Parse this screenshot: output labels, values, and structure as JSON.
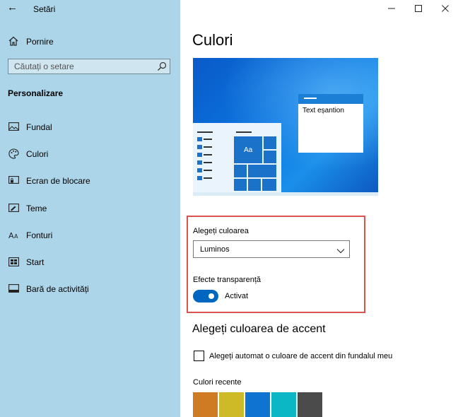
{
  "titlebar": {
    "back_icon": "back-arrow-icon",
    "title": "Setări",
    "controls": [
      "minimize-icon",
      "maximize-icon",
      "close-icon"
    ]
  },
  "sidebar": {
    "home": {
      "label": "Pornire",
      "icon": "home-icon"
    },
    "search": {
      "placeholder": "Căutați o setare",
      "icon": "search-icon"
    },
    "section_title": "Personalizare",
    "items": [
      {
        "label": "Fundal",
        "icon": "picture-icon"
      },
      {
        "label": "Culori",
        "icon": "palette-icon"
      },
      {
        "label": "Ecran de blocare",
        "icon": "lock-screen-icon"
      },
      {
        "label": "Teme",
        "icon": "themes-icon"
      },
      {
        "label": "Fonturi",
        "icon": "fonts-icon"
      },
      {
        "label": "Start",
        "icon": "start-icon"
      },
      {
        "label": "Bară de activități",
        "icon": "taskbar-icon"
      }
    ]
  },
  "main": {
    "title": "Culori",
    "preview": {
      "sample_text": "Text eșantion",
      "tile_text": "Aa"
    },
    "choose_color": {
      "label": "Alegeți culoarea",
      "selected": "Luminos"
    },
    "transparency": {
      "label": "Efecte transparență",
      "state": "Activat",
      "on": true
    },
    "accent": {
      "heading": "Alegeți culoarea de accent",
      "auto_checkbox_label": "Alegeți automat o culoare de accent din fundalul meu",
      "auto_checked": false,
      "recent_label": "Culori recente",
      "recent_colors": [
        "#ce7b24",
        "#ceba26",
        "#0f73d1",
        "#0bb7c4",
        "#4b4b4b"
      ]
    }
  },
  "colors": {
    "sidebar_bg": "#acd5e9",
    "accent": "#0067c0",
    "highlight_border": "#d9534f"
  }
}
